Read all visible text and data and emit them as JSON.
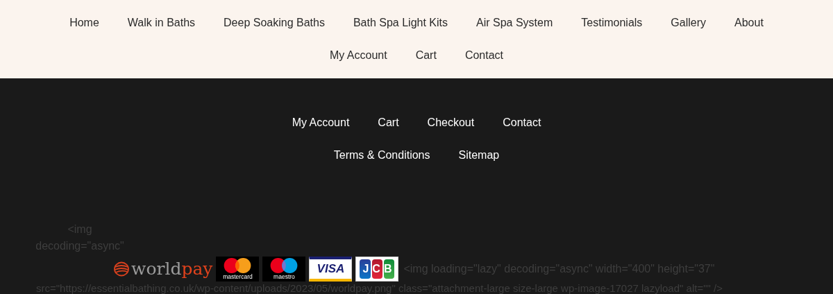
{
  "header_nav": {
    "items": [
      "Home",
      "Walk in Baths",
      "Deep Soaking Baths",
      "Bath Spa Light Kits",
      "Air Spa System",
      "Testimonials",
      "Gallery",
      "About",
      "My Account",
      "Cart",
      "Contact"
    ]
  },
  "footer_nav": {
    "items": [
      "My Account",
      "Cart",
      "Checkout",
      "Contact",
      "Terms & Conditions",
      "Sitemap"
    ]
  },
  "code_fragments": {
    "left_lines": [
      "<img",
      "decoding=\"async\""
    ],
    "inline": "<img loading=\"lazy\" decoding=\"async\" width=\"400\" height=\"37\"",
    "last_line": "src=\"https://essentialbathing.co.uk/wp-content/uploads/2023/05/worldpay.png\" class=\"attachment-large size-large wp-image-17027 lazyload\" alt=\"\" />"
  },
  "payment_logos": [
    {
      "kind": "worldpay",
      "text": "world",
      "accent": "pay"
    },
    {
      "kind": "mastercard",
      "text": "mastercard"
    },
    {
      "kind": "maestro",
      "text": "maestro"
    },
    {
      "kind": "visa",
      "text": "VISA"
    },
    {
      "kind": "jcb",
      "text": "JCB"
    }
  ]
}
